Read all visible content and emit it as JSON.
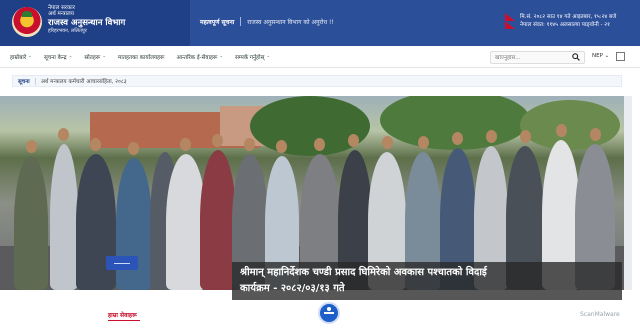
{
  "header": {
    "gov_line1": "नेपाल सरकार",
    "gov_line2": "अर्थ मन्त्रालय",
    "org_name": "राजस्व अनुसन्धान विभाग",
    "address": "हरिहरभवन, ललितपुर",
    "notice_label": "महत्वपूर्ण सूचना",
    "notice_text": "राजस्व अनुसन्धान विभाग को अनुरोध !!",
    "date_line": "मि.सं. २०८२ साउ १४ गते आइतबार, १५:२४ बजे",
    "fiscal_line": "नेपाल संवत: ११४५ अलसाल्या पाङ्वोनी - २१"
  },
  "nav": {
    "items": [
      {
        "label": "हाम्रोबारे"
      },
      {
        "label": "सूचना केन्द्र"
      },
      {
        "label": "स्रोतहरू"
      },
      {
        "label": "मातहतका कार्यालयहरू"
      },
      {
        "label": "आन्तरिक ई-सेवाहरू"
      },
      {
        "label": "सम्पर्क गर्नुहोस्"
      }
    ],
    "search_placeholder": "खोज्नुहोस...",
    "lang": "NEP"
  },
  "ticker": {
    "label": "सूचना",
    "text": "अर्थ मन्त्रालय कर्मचारी आचारसंहिता, २०८३"
  },
  "hero": {
    "caption_line1": "श्रीमान् महानिर्देशक चण्डी प्रसाद घिमिरेको अवकास पश्चातको विदाई",
    "caption_line2": "कार्यक्रम - २०८२/०३/१३ गते"
  },
  "bottom": {
    "section_title": "हाम्रा सेवाहरू",
    "watermark": "ScanMalware"
  },
  "colors": {
    "header_bg": "#2c4f9a",
    "accent_red": "#c8102e"
  }
}
